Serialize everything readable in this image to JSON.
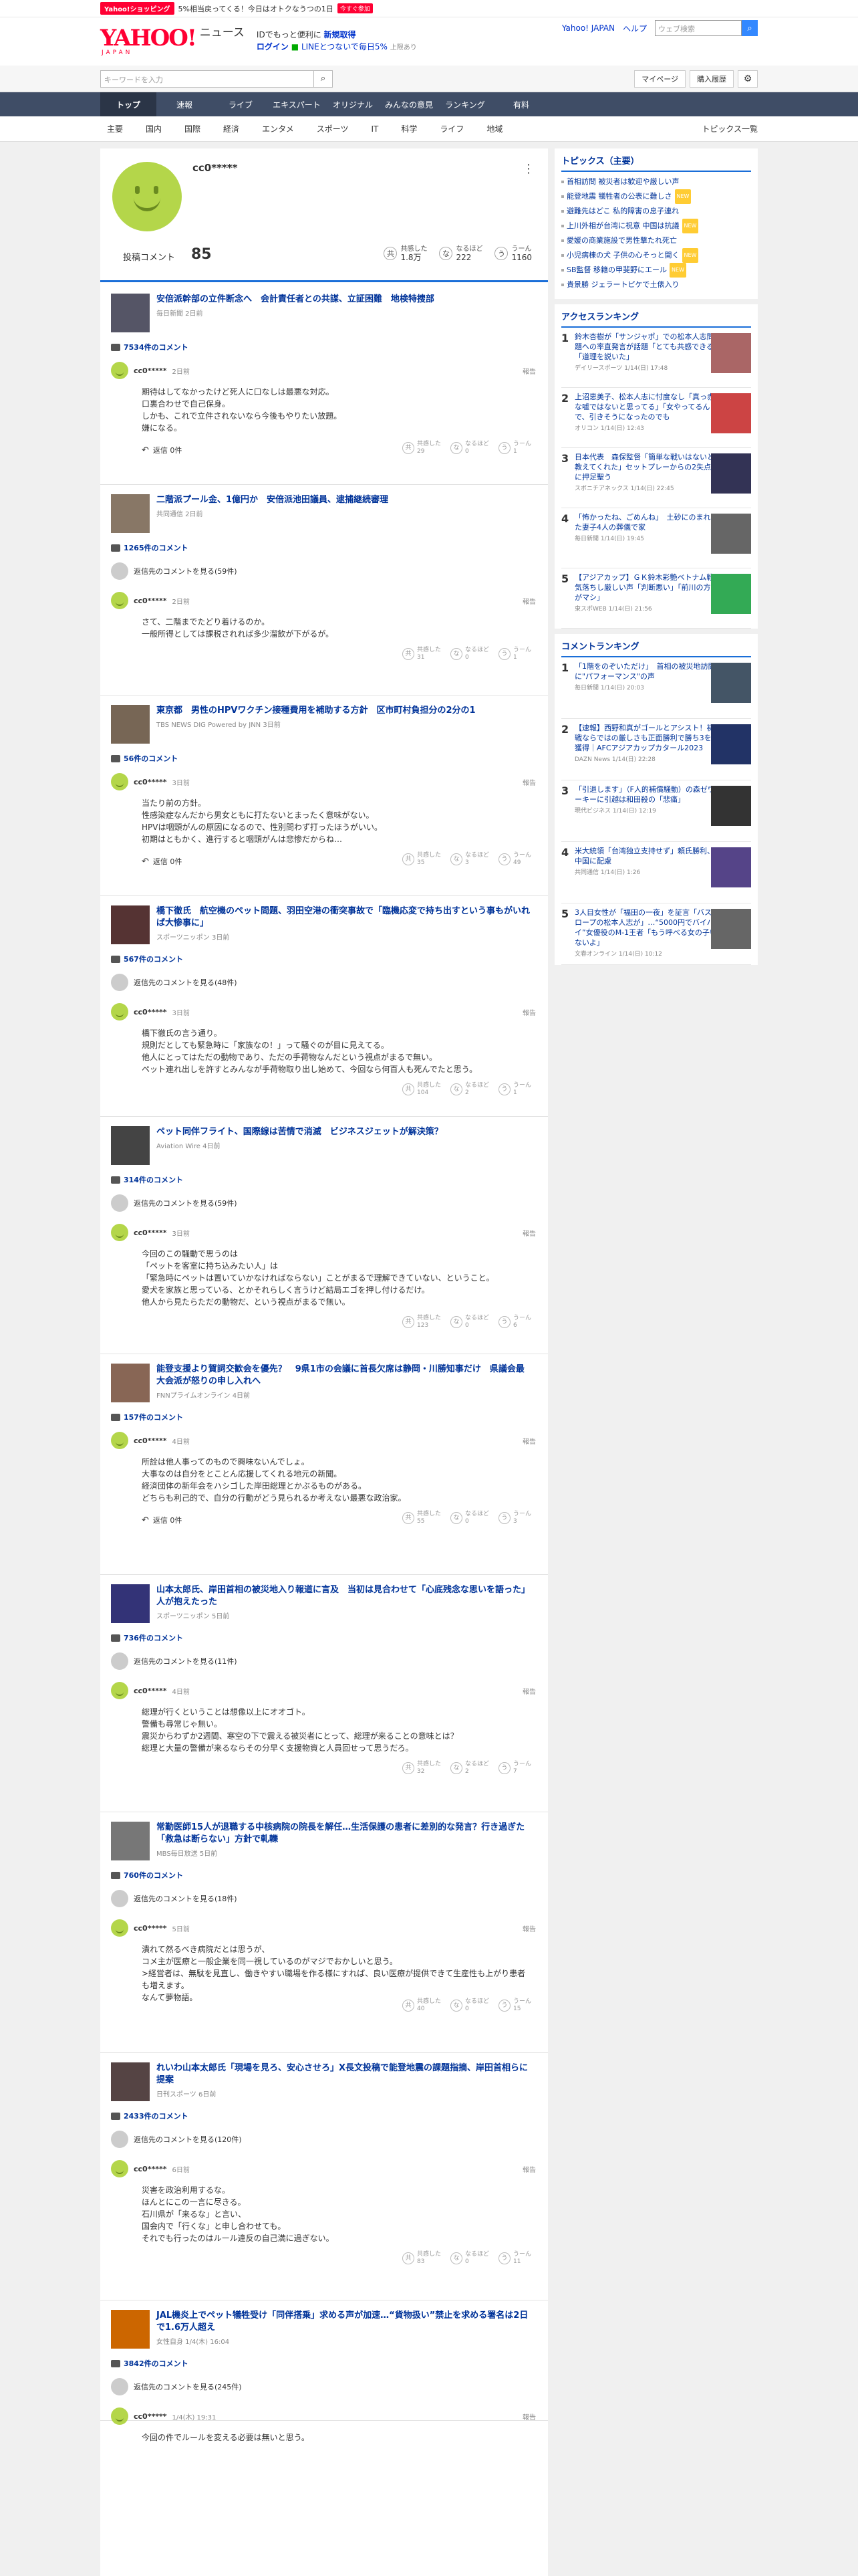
{
  "top_bar": {
    "shop": "Yahoo!ショッピング",
    "promo": "5%相当戻ってくる！今日はオトクなうつの1日",
    "tag": "今すぐ参加",
    "promo2": "IDでもっと便利に",
    "register": "新規取得",
    "login": "ログイン",
    "line": "LINEとつないで毎日5%",
    "line2": "上限あり"
  },
  "header": {
    "logo": "YAHOO!",
    "logo_sub": "ニュース",
    "japan": "JAPAN",
    "link1": "Yahoo! JAPAN",
    "link2": "ヘルプ",
    "search_placeholder": "ウェブ検索"
  },
  "search_bar": {
    "placeholder": "キーワードを入力",
    "mypage": "マイページ",
    "purchase": "購入履歴"
  },
  "global_nav": [
    {
      "label": "トップ",
      "active": true
    },
    {
      "label": "速報"
    },
    {
      "label": "ライブ"
    },
    {
      "label": "エキスパート"
    },
    {
      "label": "オリジナル"
    },
    {
      "label": "みんなの意見"
    },
    {
      "label": "ランキング"
    },
    {
      "label": "有料"
    }
  ],
  "sub_nav": [
    "主要",
    "国内",
    "国際",
    "経済",
    "エンタメ",
    "スポーツ",
    "IT",
    "科学",
    "ライフ",
    "地域"
  ],
  "sub_nav_right": "トピックス一覧",
  "profile": {
    "name": "cc0*****",
    "count_label": "投稿コメント",
    "count": "85",
    "stats": [
      {
        "icon": "共",
        "label": "共感した",
        "value": "1.8万"
      },
      {
        "icon": "な",
        "label": "なるほど",
        "value": "222"
      },
      {
        "icon": "う",
        "label": "うーん",
        "value": "1160"
      }
    ]
  },
  "common": {
    "report": "報告",
    "reply": "返信",
    "show_prev": "返信先のコメントを見る",
    "rx1": "共感した",
    "rx2": "なるほど",
    "rx3": "うーん"
  },
  "entries": [
    {
      "title": "安倍派幹部の立件断念へ　会計責任者との共謀、立証困難　地検特捜部",
      "src": "毎日新聞 2日前",
      "count": "7534件のコメント",
      "time": "2日前",
      "text": [
        "期待はしてなかったけど死人に口なしは最悪な対応。",
        "口裏合わせで自己保身。",
        "しかも、これで立件されないなら今後もやりたい放題。",
        "嫌になる。"
      ],
      "replies": "返信 0件",
      "r": [
        "29",
        "0",
        "1"
      ],
      "thumb": "#556"
    },
    {
      "title": "二階派プール金、1億円か　安倍派池田議員、逮捕継続審理",
      "src": "共同通信 2日前",
      "count": "1265件のコメント",
      "prev": "返信先のコメントを見る(59件)",
      "time": "2日前",
      "text": [
        "さて、二階までたどり着けるのか。",
        "一般所得としては課税されれば多少溜飲が下がるが。"
      ],
      "r": [
        "31",
        "0",
        "1"
      ],
      "thumb": "#876"
    },
    {
      "title": "東京都　男性のHPVワクチン接種費用を補助する方針　区市町村負担分の2分の1",
      "src": "TBS NEWS DIG Powered by JNN 3日前",
      "count": "56件のコメント",
      "time": "3日前",
      "text": [
        "当たり前の方針。",
        "性感染症なんだから男女ともに打たないとまったく意味がない。",
        "HPVは咽頭がんの原因になるので、性別問わず打ったほうがいい。",
        "初期はともかく、進行すると咽頭がんは悲惨だからね…"
      ],
      "replies": "返信 0件",
      "r": [
        "35",
        "3",
        "49"
      ],
      "thumb": "#765"
    },
    {
      "title": "橋下徹氏　航空機のペット問題、羽田空港の衝突事故で「臨機応変で持ち出すという事もがいれば大惨事に」",
      "src": "スポーツニッポン 3日前",
      "count": "567件のコメント",
      "prev": "返信先のコメントを見る(48件)",
      "time": "3日前",
      "text": [
        "橋下徹氏の言う通り。",
        "規則だとしても緊急時に「家族なの！」って騒ぐのが目に見えてる。",
        "他人にとってはただの動物であり、ただの手荷物なんだという視点がまるで無い。",
        "ペット連れ出しを許すとみんなが手荷物取り出し始めて、今回なら何百人も死んでたと思う。"
      ],
      "r": [
        "104",
        "2",
        "1"
      ],
      "thumb": "#533"
    },
    {
      "title": "ペット同伴フライト、国際線は苦情で消滅　ビジネスジェットが解決策？",
      "src": "Aviation Wire 4日前",
      "count": "314件のコメント",
      "prev": "返信先のコメントを見る(59件)",
      "time": "3日前",
      "text": [
        "今回のこの騒動で思うのは",
        "「ペットを客室に持ち込みたい人」は",
        "「緊急時にペットは置いていかなければならない」ことがまるで理解できていない、ということ。",
        "愛犬を家族と思っている、とかそれらしく言うけど結局エゴを押し付けるだけ。",
        "他人から見たらただの動物だ、という視点がまるで無い。"
      ],
      "r": [
        "123",
        "0",
        "6"
      ],
      "thumb": "#444"
    },
    {
      "title": "能登支援より賀詞交歓会を優先？　9県1市の会議に首長欠席は静岡・川勝知事だけ　県議会最大会派が怒りの申し入れへ",
      "src": "FNNプライムオンライン 4日前",
      "count": "157件のコメント",
      "time": "4日前",
      "text": [
        "所詮は他人事ってのもので興味ないんでしょ。",
        "大事なのは自分をとことん応援してくれる地元の新聞。",
        "経済団体の新年会をハシゴした岸田総理とかぶるものがある。",
        "どちらも利己的で、自分の行動がどう見られるか考えない最悪な政治家。"
      ],
      "replies": "返信 0件",
      "r": [
        "55",
        "0",
        "3"
      ],
      "thumb": "#865"
    },
    {
      "title": "山本太郎氏、岸田首相の被災地入り報道に言及　当初は見合わせて「心底残念な思いを語った」人が抱えたった",
      "src": "スポーツニッポン 5日前",
      "count": "736件のコメント",
      "prev": "返信先のコメントを見る(11件)",
      "time": "4日前",
      "text": [
        "総理が行くということは想像以上にオオゴト。",
        "警備も尋常じゃ無い。",
        "震災からわずか2週間、寒空の下で震える被災者にとって、総理が来ることの意味とは？",
        "総理と大量の警備が来るならその分早く支援物資と人員回せって思うだろ。"
      ],
      "r": [
        "32",
        "2",
        "7"
      ],
      "thumb": "#337"
    },
    {
      "title": "常勤医師15人が退職する中核病院の院長を解任…生活保護の患者に差別的な発言？行き過ぎた「救急は断らない」方針で軋轢",
      "src": "MBS毎日放送 5日前",
      "count": "760件のコメント",
      "prev": "返信先のコメントを見る(18件)",
      "time": "5日前",
      "text": [
        "潰れて然るべき病院だとは思うが、",
        "コメ主が医療と一般企業を同一視しているのがマジでおかしいと思う。",
        ">経営者は、無駄を見直し、働きやすい職場を作る様にすれば、良い医療が提供できて生産性も上がり患者も増えます。",
        "なんて夢物語。"
      ],
      "r": [
        "40",
        "0",
        "15"
      ],
      "thumb": "#777"
    },
    {
      "title": "れいわ山本太郎氏「現場を見ろ、安心させろ」X長文投稿で能登地震の課題指摘、岸田首相らに提案",
      "src": "日刊スポーツ 6日前",
      "count": "2433件のコメント",
      "prev": "返信先のコメントを見る(120件)",
      "time": "6日前",
      "text": [
        "災害を政治利用するな。",
        "ほんとにこの一言に尽きる。",
        "石川県が「来るな」と言い、",
        "国会内で「行くな」と申し合わせても。",
        "それでも行ったのはルール違反の自己満に過ぎない。"
      ],
      "r": [
        "83",
        "0",
        "11"
      ],
      "thumb": "#544"
    },
    {
      "title": "JAL機炎上でペット犠牲受け「同伴搭乗」求める声が加速…“貨物扱い”禁止を求める署名は2日で1.6万人超え",
      "src": "女性自身 1/4(木) 16:04",
      "count": "3842件のコメント",
      "prev": "返信先のコメントを見る(245件)",
      "time": "1/4(木) 19:31",
      "text": [
        "今回の件でルールを変える必要は無いと思う。"
      ],
      "r": [
        "",
        "",
        ""
      ],
      "thumb": "#c60"
    }
  ],
  "topics": {
    "title": "トピックス（主要）",
    "items": [
      {
        "t": "首相訪問 被災者は歓迎や厳しい声"
      },
      {
        "t": "能登地震 犠牲者の公表に難しさ",
        "new": "NEW"
      },
      {
        "t": "避難先はどこ 私的障害の息子連れ"
      },
      {
        "t": "上川外相が台湾に祝意 中国は抗議",
        "new": "NEW"
      },
      {
        "t": "愛媛の商業施設で男性撃たれ死亡"
      },
      {
        "t": "小児病棟の犬 子供の心そっと開く",
        "new": "NEW"
      },
      {
        "t": "SB監督 移籍の甲斐野にエール",
        "new": "NEW"
      },
      {
        "t": "貴景勝 ジェラートピケで土俵入り"
      }
    ]
  },
  "access_ranking": {
    "title": "アクセスランキング",
    "items": [
      {
        "t": "鈴木杏樹が「サンジャポ」での松本人志問題への率直発言が話題「とても共感できる」「道理を説いた」",
        "s": "デイリースポーツ 1/14(日) 17:48",
        "c": "#a66"
      },
      {
        "t": "上沼恵美子、松本人志に忖度なし「真っ赤な嘘ではないと思ってる」「女やってるんで、引きそうになったのでも",
        "s": "オリコン 1/14(日) 12:43",
        "c": "#c44"
      },
      {
        "t": "日本代表　森保監督「簡単な戦いはないと教えてくれた」セットプレーからの2失点に押足聖う",
        "s": "スポニチアネックス 1/14(日) 22:45",
        "c": "#335"
      },
      {
        "t": "「怖かったね、ごめんね」　土砂にのまれた妻子4人の葬儀で家",
        "s": "毎日新聞 1/14(日) 19:45",
        "c": "#666"
      },
      {
        "t": "【アジアカップ】ＧＫ鈴木彩艶ベトナム戦気落ちし厳しい声「判断悪い」「前川の方がマシ」",
        "s": "東スポWEB 1/14(日) 21:56",
        "c": "#3a5"
      }
    ]
  },
  "comment_ranking": {
    "title": "コメントランキング",
    "items": [
      {
        "t": "「1階をのぞいただけ」　首相の被災地訪問に\"パフォーマンス\"の声",
        "s": "毎日新聞 1/14(日) 20:03",
        "c": "#456"
      },
      {
        "t": "【速報】西野和真がゴールとアシスト！初戦ならではの厳しさも正面勝利で勝ち3を獲得｜AFCアジアカップカタール2023",
        "s": "DAZN News 1/14(日) 22:28",
        "c": "#236"
      },
      {
        "t": "「引退します」（F人的補償騒動）の森ゼワーキーに引越は和田殺の「悲痛」",
        "s": "現代ビジネス 1/14(日) 12:19",
        "c": "#333"
      },
      {
        "t": "米大統領「台湾独立支持せず」頼氏勝利、中国に配慮",
        "s": "共同通信 1/14(日) 1:26",
        "c": "#548"
      },
      {
        "t": "3人目女性が「福田の一夜」を証言「バスロープの松本人志が」…“5000円でバイバイ”女優役のM-1王者「もう呼べる女の子いないよ」",
        "s": "文春オンライン 1/14(日) 10:12",
        "c": "#666"
      }
    ]
  }
}
